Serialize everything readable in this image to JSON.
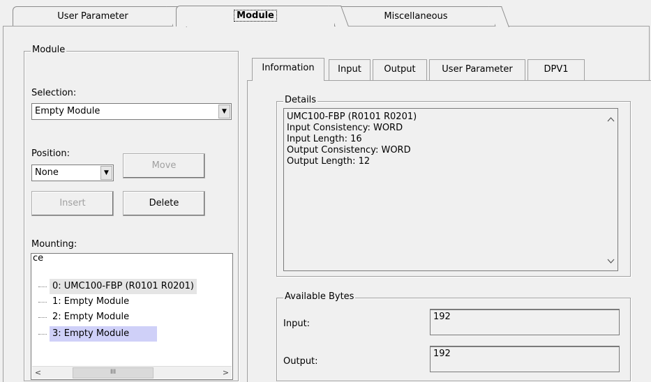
{
  "outer_tabs": [
    {
      "label": "User Parameter",
      "active": false
    },
    {
      "label": "Module",
      "active": true
    },
    {
      "label": "Miscellaneous",
      "active": false
    }
  ],
  "module_group": {
    "title": "Module",
    "selection_label": "Selection:",
    "selection_value": "Empty Module",
    "position_label": "Position:",
    "position_value": "None",
    "move_label": "Move",
    "insert_label": "Insert",
    "delete_label": "Delete",
    "mounting_label": "Mounting:",
    "mounting_root": "ce",
    "mounting_items": [
      "0: UMC100-FBP (R0101 R0201)",
      "1: Empty Module",
      "2: Empty Module",
      "3: Empty Module"
    ],
    "scroll_thumb": "III"
  },
  "inner_tabs": [
    {
      "label": "Information",
      "active": true
    },
    {
      "label": "Input",
      "active": false
    },
    {
      "label": "Output",
      "active": false
    },
    {
      "label": "User Parameter",
      "active": false
    },
    {
      "label": "DPV1",
      "active": false
    }
  ],
  "details": {
    "title": "Details",
    "lines": [
      "UMC100-FBP (R0101 R0201)",
      "Input Consistency: WORD",
      "Input Length: 16",
      "Output Consistency: WORD",
      "Output Length: 12"
    ]
  },
  "available_bytes": {
    "title": "Available Bytes",
    "input_label": "Input:",
    "input_value": "192",
    "output_label": "Output:",
    "output_value": "192"
  },
  "colors": {
    "selection_highlight": "#cfd0f8",
    "focus_highlight": "#e5e5e5"
  }
}
